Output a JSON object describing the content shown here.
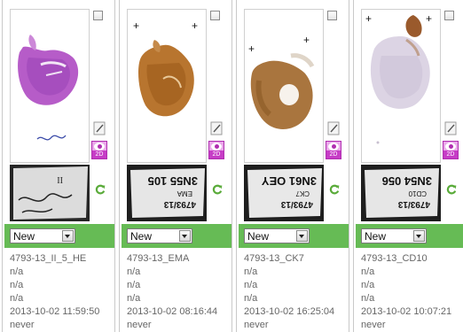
{
  "colors": {
    "status_bar": "#66bb55",
    "badge": "#c63cc6",
    "refresh": "#5aab3a"
  },
  "cards": [
    {
      "stain": "HE",
      "status": "New",
      "name": "4793-13_II_5_HE",
      "field1": "n/a",
      "field2": "n/a",
      "field3": "n/a",
      "date": "2013-10-02 11:59:50",
      "last": "never",
      "badge_label": "2D",
      "label_photo_text": [
        "4793-13 II 5",
        "II"
      ],
      "handwriting": "4793-13"
    },
    {
      "stain": "EMA",
      "status": "New",
      "name": "4793-13_EMA",
      "field1": "n/a",
      "field2": "n/a",
      "field3": "n/a",
      "date": "2013-10-02 08:16:44",
      "last": "never",
      "badge_label": "2D",
      "label_photo_text": [
        "4793/13",
        "EMA",
        "3N55 105"
      ]
    },
    {
      "stain": "CK7",
      "status": "New",
      "name": "4793-13_CK7",
      "field1": "n/a",
      "field2": "n/a",
      "field3": "n/a",
      "date": "2013-10-02 16:25:04",
      "last": "never",
      "badge_label": "2D",
      "label_photo_text": [
        "4793/13",
        "CK7",
        "3N61 OEY"
      ]
    },
    {
      "stain": "CD10",
      "status": "New",
      "name": "4793-13_CD10",
      "field1": "n/a",
      "field2": "n/a",
      "field3": "n/a",
      "date": "2013-10-02 10:07:21",
      "last": "never",
      "badge_label": "2D",
      "label_photo_text": [
        "4793/13",
        "CD10",
        "3N54 056"
      ]
    }
  ]
}
